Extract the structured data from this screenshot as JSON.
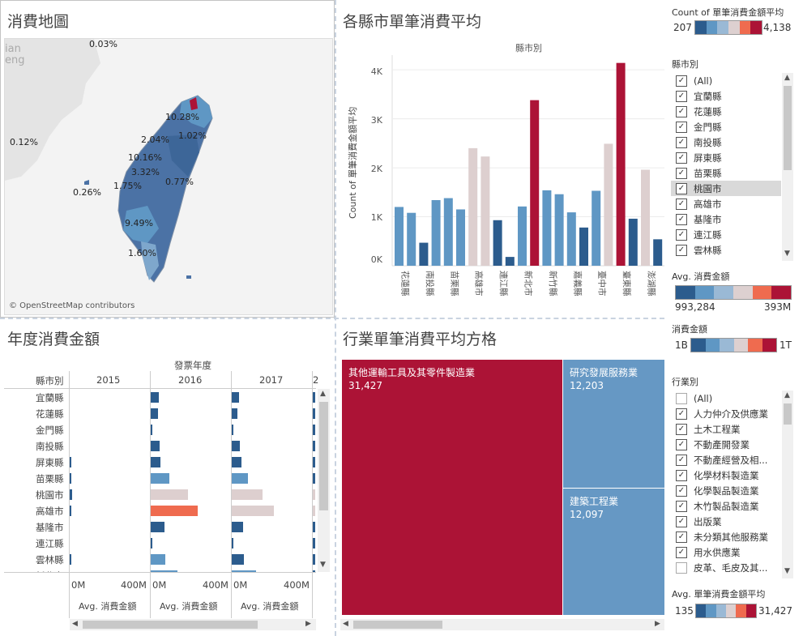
{
  "panels": {
    "map_title": "消費地圖",
    "bar_title": "各縣市單筆消費平均",
    "year_title": "年度消費金額",
    "treemap_title": "行業單筆消費平均方格"
  },
  "map": {
    "attribution": "© OpenStreetMap contributors",
    "bg_label": "ian\neng",
    "labels": [
      "0.03%",
      "10.28%",
      "1.02%",
      "2.04%",
      "0.12%",
      "10.16%",
      "3.32%",
      "1.75%",
      "0.77%",
      "0.26%",
      "9.49%",
      "1.60%"
    ]
  },
  "bar_chart": {
    "header": "縣市別",
    "ylabel": "Count of 單筆消費金額平均",
    "yticks": [
      "4K",
      "3K",
      "2K",
      "1K",
      "0K"
    ]
  },
  "chart_data": {
    "type": "bar",
    "title": "各縣市單筆消費平均",
    "xlabel": "縣市別",
    "ylabel": "Count of 單筆消費金額平均",
    "ylim": [
      0,
      4300
    ],
    "categories": [
      "花蓮縣",
      "",
      "南投縣",
      "",
      "苗栗縣",
      "",
      "高雄市",
      "",
      "連江縣",
      "",
      "新北市",
      "",
      "新竹縣",
      "",
      "嘉義縣",
      "",
      "臺中市",
      "",
      "臺東縣",
      "",
      "澎湖縣"
    ],
    "values": [
      1200,
      1080,
      470,
      1340,
      1380,
      1150,
      2400,
      2230,
      930,
      180,
      1210,
      3380,
      1540,
      1460,
      1090,
      780,
      1530,
      2490,
      4140,
      960,
      1960,
      540
    ],
    "colors": [
      "#5f97c4",
      "#5f97c4",
      "#2c5c8d",
      "#5f97c4",
      "#5f97c4",
      "#5f97c4",
      "#ddcfcf",
      "#ddcfcf",
      "#2c5c8d",
      "#2c5c8d",
      "#5f97c4",
      "#ac1336",
      "#5f97c4",
      "#5f97c4",
      "#5f97c4",
      "#2c5c8d",
      "#5f97c4",
      "#ddcfcf",
      "#ac1336",
      "#2c5c8d",
      "#ddcfcf",
      "#2c5c8d"
    ]
  },
  "legends": {
    "count_title": "Count of 單筆消費金額平均",
    "count_min": "207",
    "count_max": "4,138",
    "avg_title": "Avg. 消費金額",
    "avg_min": "993,284",
    "avg_max": "393M",
    "amount_title": "消費金額",
    "amount_min": "1B",
    "amount_max": "1T",
    "avg_single_title": "Avg. 單筆消費金額平均",
    "avg_single_min": "135",
    "avg_single_max": "31,427",
    "ramp_colors": [
      "#2c5c8d",
      "#5f97c4",
      "#9ab9d5",
      "#ddd0d0",
      "#ef6b4f",
      "#ac1336"
    ]
  },
  "county_filter": {
    "title": "縣市別",
    "items": [
      {
        "label": "(All)",
        "checked": true
      },
      {
        "label": "宜蘭縣",
        "checked": true
      },
      {
        "label": "花蓮縣",
        "checked": true
      },
      {
        "label": "金門縣",
        "checked": true
      },
      {
        "label": "南投縣",
        "checked": true
      },
      {
        "label": "屏東縣",
        "checked": true
      },
      {
        "label": "苗栗縣",
        "checked": true
      },
      {
        "label": "桃園市",
        "checked": true
      },
      {
        "label": "高雄市",
        "checked": true
      },
      {
        "label": "基隆市",
        "checked": true
      },
      {
        "label": "連江縣",
        "checked": true
      },
      {
        "label": "雲林縣",
        "checked": true
      }
    ]
  },
  "industry_filter": {
    "title": "行業別",
    "items": [
      {
        "label": "(All)",
        "checked": false
      },
      {
        "label": "人力仲介及供應業",
        "checked": true
      },
      {
        "label": "土木工程業",
        "checked": true
      },
      {
        "label": "不動產開發業",
        "checked": true
      },
      {
        "label": "不動產經營及相...",
        "checked": true
      },
      {
        "label": "化學材料製造業",
        "checked": true
      },
      {
        "label": "化學製品製造業",
        "checked": true
      },
      {
        "label": "木竹製品製造業",
        "checked": true
      },
      {
        "label": "出版業",
        "checked": true
      },
      {
        "label": "未分類其他服務業",
        "checked": true
      },
      {
        "label": "用水供應業",
        "checked": true
      },
      {
        "label": "皮革、毛皮及其...",
        "checked": false
      }
    ]
  },
  "year_table": {
    "header_top": "發票年度",
    "row_header": "縣市別",
    "years": [
      "2015",
      "2016",
      "2017",
      "2"
    ],
    "rows": [
      "宜蘭縣",
      "花蓮縣",
      "金門縣",
      "南投縣",
      "屏東縣",
      "苗栗縣",
      "桃園市",
      "高雄市",
      "基隆市",
      "連江縣",
      "雲林縣",
      "新北市"
    ],
    "axis_ticks": [
      "0M",
      "400M",
      "0M",
      "400M",
      "0M",
      "400M"
    ],
    "axis_label": "Avg. 消費金額",
    "values_2015": [
      0,
      0,
      0,
      0,
      2,
      2,
      6,
      4,
      0,
      0,
      2,
      0
    ],
    "values_2016": [
      20,
      18,
      4,
      22,
      24,
      46,
      92,
      116,
      34,
      2,
      36,
      66
    ],
    "values_2017": [
      18,
      14,
      2,
      20,
      24,
      40,
      76,
      104,
      28,
      1,
      30,
      60
    ],
    "colors_2016": [
      "#2c5c8d",
      "#2c5c8d",
      "#2c5c8d",
      "#2c5c8d",
      "#2c5c8d",
      "#5f97c4",
      "#ddcfcf",
      "#ef6b4f",
      "#2c5c8d",
      "#2c5c8d",
      "#5f97c4",
      "#5f97c4"
    ],
    "colors_2017": [
      "#2c5c8d",
      "#2c5c8d",
      "#2c5c8d",
      "#2c5c8d",
      "#2c5c8d",
      "#5f97c4",
      "#ddcfcf",
      "#ddcfcf",
      "#2c5c8d",
      "#2c5c8d",
      "#2c5c8d",
      "#5f97c4"
    ]
  },
  "treemap": {
    "cells": [
      {
        "label": "其他運輸工具及其零件製造業",
        "value": "31,427"
      },
      {
        "label": "研究發展服務業",
        "value": "12,203"
      },
      {
        "label": "建築工程業",
        "value": "12,097"
      }
    ]
  }
}
